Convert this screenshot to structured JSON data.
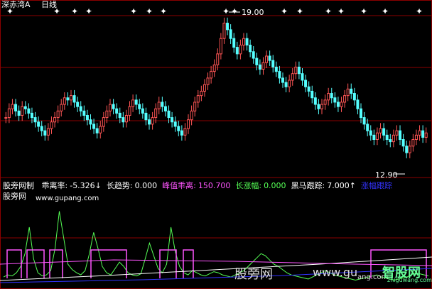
{
  "header": {
    "market": "深赤湾A",
    "period": "日线"
  },
  "price_markers": {
    "high_label": "19.00",
    "low_label": "12.90"
  },
  "indicator": {
    "name": "股旁网制",
    "items": [
      {
        "label": "乖离率:",
        "value": "-5.326↓",
        "color": "#ffffff"
      },
      {
        "label": "长趋势:",
        "value": "0.000",
        "color": "#ffffff"
      },
      {
        "label": "峰值乖离:",
        "value": "150.700",
        "color": "#ff55ff"
      },
      {
        "label": "长涨幅:",
        "value": "0.000",
        "color": "#55ff55"
      },
      {
        "label": "黑马跟踪:",
        "value": "7.000↑",
        "color": "#ffffff"
      },
      {
        "label": "涨幅跟踪",
        "value": "",
        "color": "#3333ff"
      }
    ],
    "sub_title": "股旁网",
    "sub_url": "www.gupang.com"
  },
  "watermarks": {
    "text1": "股旁网",
    "text2": "www.gu",
    "text3": "ang.com",
    "logo": "智股网",
    "logo_url": "zhiguwang.com"
  },
  "colors": {
    "up": "#ff5555",
    "down": "#55ffff",
    "grid": "#8b0000",
    "ma": "#ffffff"
  },
  "chart_data": [
    {
      "type": "candlestick",
      "title": "",
      "ylim": [
        12.0,
        19.5
      ],
      "close": [
        14.6,
        15.0,
        15.2,
        14.9,
        14.7,
        15.1,
        15.0,
        14.8,
        14.6,
        14.4,
        14.2,
        14.0,
        13.8,
        14.1,
        14.4,
        14.6,
        14.9,
        15.2,
        15.5,
        15.4,
        15.6,
        15.3,
        15.1,
        14.9,
        14.7,
        14.5,
        14.3,
        14.1,
        13.9,
        14.2,
        14.6,
        14.9,
        15.2,
        15.0,
        14.8,
        14.6,
        14.4,
        14.7,
        15.1,
        15.4,
        15.2,
        15.0,
        14.8,
        14.5,
        14.3,
        14.6,
        15.0,
        15.3,
        15.1,
        14.9,
        14.6,
        14.4,
        14.2,
        14.0,
        13.8,
        14.1,
        14.5,
        14.9,
        15.3,
        15.6,
        15.8,
        16.1,
        16.4,
        16.7,
        17.0,
        17.5,
        18.2,
        18.9,
        18.6,
        18.2,
        17.8,
        17.5,
        17.9,
        18.2,
        17.9,
        17.6,
        17.3,
        17.0,
        16.8,
        17.1,
        17.4,
        17.2,
        16.9,
        16.7,
        16.4,
        16.2,
        16.0,
        16.3,
        16.6,
        16.9,
        16.6,
        16.3,
        16.0,
        15.8,
        15.5,
        15.2,
        15.0,
        15.2,
        15.4,
        15.7,
        15.5,
        15.3,
        15.1,
        15.3,
        15.6,
        15.9,
        15.7,
        15.4,
        15.0,
        14.6,
        14.3,
        14.0,
        13.8,
        13.6,
        13.9,
        14.1,
        13.8,
        13.6,
        13.5,
        13.8,
        14.0,
        13.6,
        13.3,
        13.0,
        13.3,
        13.6,
        13.8,
        14.0,
        13.7,
        13.9
      ],
      "markers": [
        "19.00",
        "12.90"
      ]
    },
    {
      "type": "line",
      "title": "",
      "series": [
        {
          "name": "乖离率",
          "values": [
            8,
            10,
            9,
            12,
            18,
            30,
            55,
            25,
            12,
            9,
            10,
            14,
            35,
            70,
            45,
            20,
            15,
            12,
            10,
            14,
            30,
            50,
            35,
            18,
            12,
            10,
            16,
            22,
            18,
            12,
            10,
            9,
            11,
            25,
            40,
            28,
            16,
            12,
            20,
            55,
            32,
            18,
            12,
            10,
            14,
            12,
            10,
            9,
            11,
            13,
            12,
            10,
            9,
            8,
            10,
            12,
            14,
            18,
            22,
            26,
            30,
            28,
            24,
            20,
            18,
            15,
            12,
            10,
            9,
            8,
            7,
            6,
            8,
            10,
            12,
            14,
            12,
            10,
            9,
            8,
            7,
            6,
            5,
            6,
            7,
            8,
            9,
            10,
            8,
            7,
            6,
            5,
            6,
            7,
            8,
            10,
            12,
            11,
            10,
            9
          ]
        }
      ]
    }
  ]
}
